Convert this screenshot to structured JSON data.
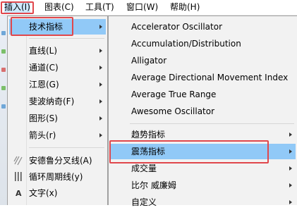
{
  "menubar": {
    "items": [
      {
        "label": "插入(I)"
      },
      {
        "label": "图表(C)"
      },
      {
        "label": "工具(T)"
      },
      {
        "label": "窗口(W)"
      },
      {
        "label": "帮助(H)"
      }
    ]
  },
  "insert_menu": {
    "items": [
      {
        "label": "技术指标"
      },
      {
        "label": "直线(L)"
      },
      {
        "label": "通道(C)"
      },
      {
        "label": "江恩(G)"
      },
      {
        "label": "斐波纳奇(F)"
      },
      {
        "label": "图形(S)"
      },
      {
        "label": "箭头(r)"
      },
      {
        "label": "安德鲁分叉线(A)"
      },
      {
        "label": "循环周期线(y)"
      },
      {
        "label": "文字(x)"
      }
    ]
  },
  "indicators_menu": {
    "items": [
      {
        "label": "Accelerator Oscillator"
      },
      {
        "label": "Accumulation/Distribution"
      },
      {
        "label": "Alligator"
      },
      {
        "label": "Average Directional Movement Index"
      },
      {
        "label": "Average True Range"
      },
      {
        "label": "Awesome Oscillator"
      },
      {
        "label": "趋势指标"
      },
      {
        "label": "震荡指标"
      },
      {
        "label": "成交量"
      },
      {
        "label": "比尔 威廉姆"
      },
      {
        "label": "自定义"
      }
    ]
  },
  "text_icon_glyph": "A",
  "colors": {
    "highlight": "#91c9f7",
    "menu_bg": "#f2f2f2",
    "annotation_red": "#e0474c",
    "menubar_active": "#cde8ff"
  }
}
